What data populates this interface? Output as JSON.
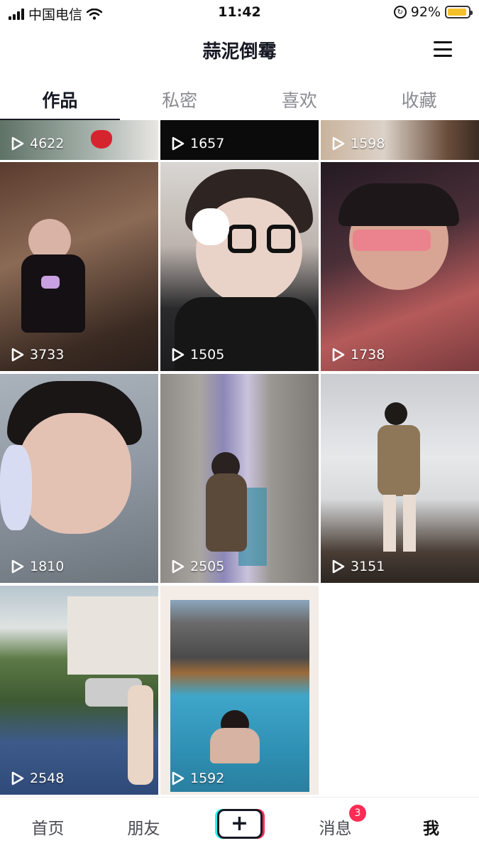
{
  "status": {
    "carrier": "中国电信",
    "time": "11:42",
    "battery": "92%",
    "battery_level": 0.92
  },
  "header": {
    "title": "蒜泥倒霉"
  },
  "tabs": [
    {
      "label": "作品",
      "active": true
    },
    {
      "label": "私密",
      "active": false
    },
    {
      "label": "喜欢",
      "active": false
    },
    {
      "label": "收藏",
      "active": false
    }
  ],
  "videos": [
    {
      "plays": "4622"
    },
    {
      "plays": "1657"
    },
    {
      "plays": "1598"
    },
    {
      "plays": "3733"
    },
    {
      "plays": "1505"
    },
    {
      "plays": "1738"
    },
    {
      "plays": "1810"
    },
    {
      "plays": "2505"
    },
    {
      "plays": "3151"
    },
    {
      "plays": "2548"
    },
    {
      "plays": "1592"
    }
  ],
  "bottom_nav": {
    "home": "首页",
    "friends": "朋友",
    "create": "+",
    "messages": "消息",
    "messages_badge": "3",
    "me": "我"
  },
  "colors": {
    "accent_red": "#fe2c55",
    "accent_cyan": "#25f4ee",
    "battery": "#f5c12a"
  }
}
